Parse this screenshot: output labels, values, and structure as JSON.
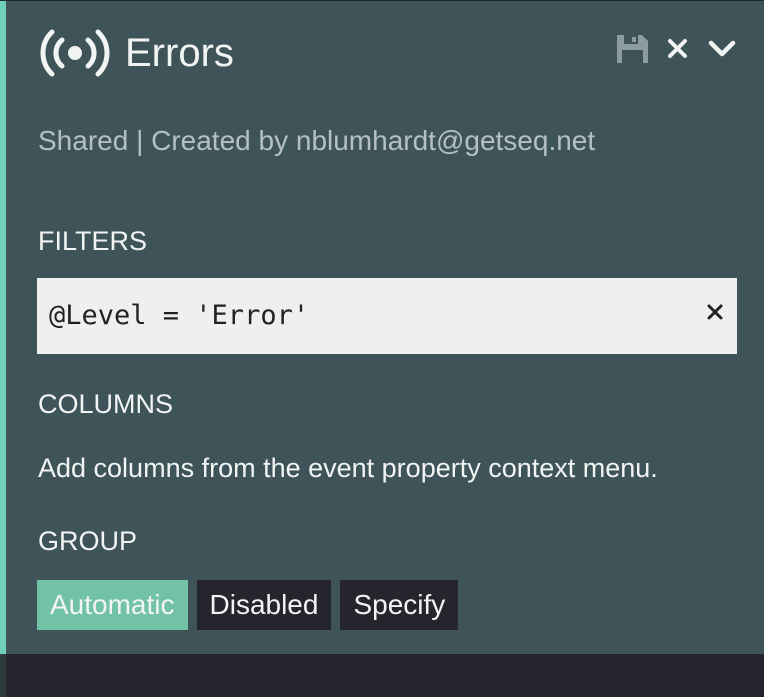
{
  "header": {
    "title": "Errors",
    "icon": "broadcast-icon",
    "actions": [
      {
        "name": "save",
        "icon": "floppy-disk-icon"
      },
      {
        "name": "close",
        "icon": "close-icon"
      },
      {
        "name": "collapse",
        "icon": "chevron-down-icon"
      }
    ]
  },
  "subtitle": "Shared | Created by nblumhardt@getseq.net",
  "filters": {
    "label": "FILTERS",
    "expression": "@Level = 'Error'",
    "clear_icon": "close-icon"
  },
  "columns": {
    "label": "COLUMNS",
    "hint": "Add columns from the event property context menu."
  },
  "group": {
    "label": "GROUP",
    "options": [
      "Automatic",
      "Disabled",
      "Specify"
    ],
    "selected": "Automatic"
  },
  "colors": {
    "panel": "#3e5458",
    "accent": "#6fd2b8",
    "active_button": "#72c2a5",
    "button": "#24252d",
    "background": "#25262d"
  }
}
